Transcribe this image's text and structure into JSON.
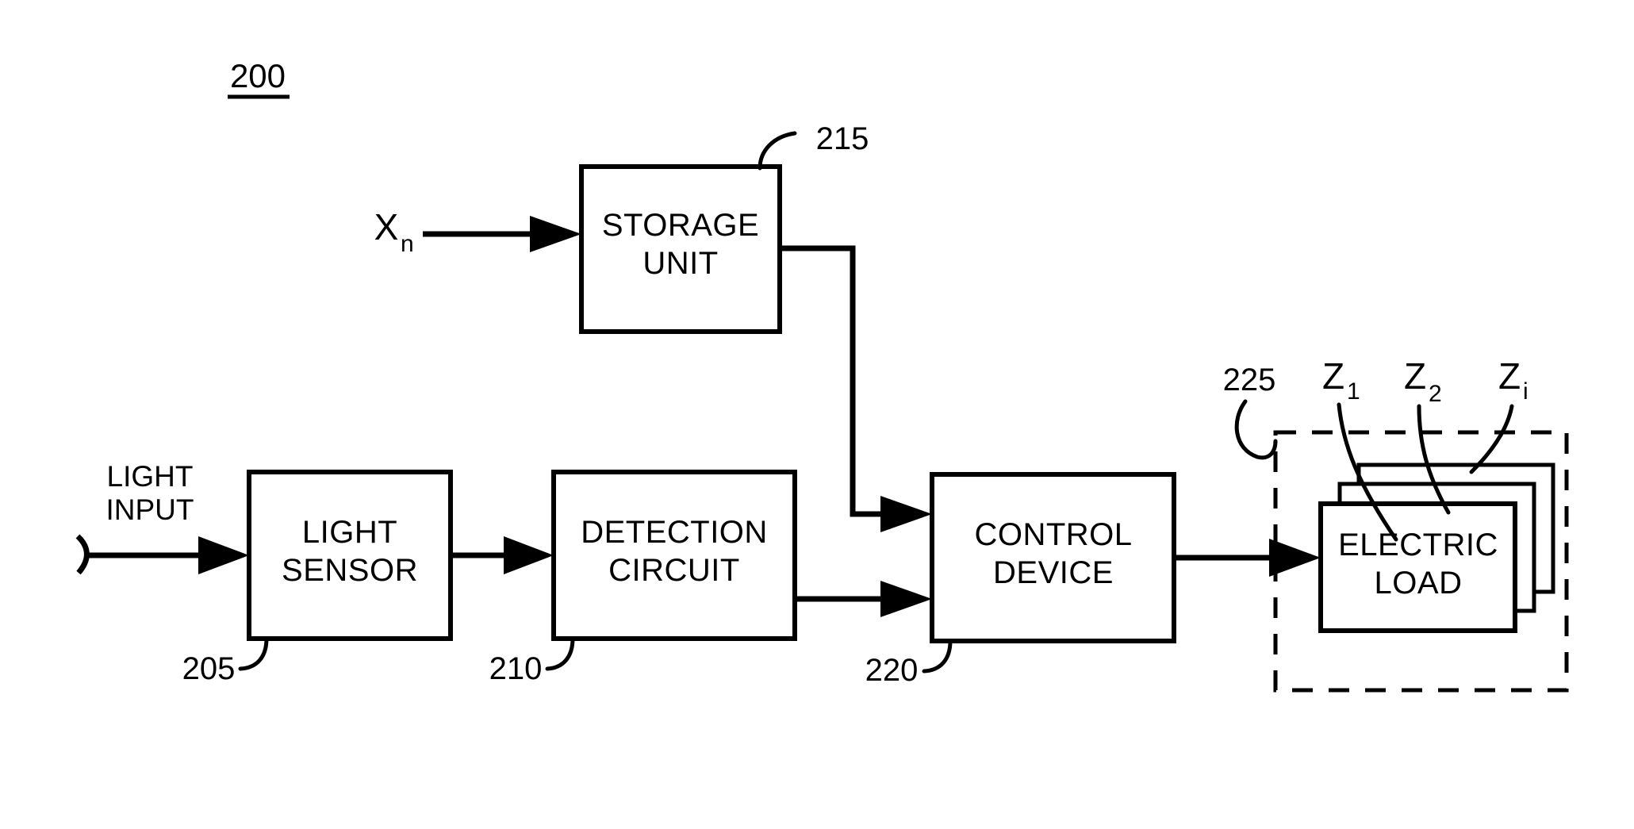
{
  "figure": {
    "number": "200",
    "background_color": "#ffffff",
    "line_color": "#000000"
  },
  "inputs": {
    "light_input_line1": "LIGHT",
    "light_input_line2": "INPUT",
    "storage_input_symbol": "X",
    "storage_input_subscript": "n"
  },
  "blocks": [
    {
      "id": "storage-unit",
      "label_line1": "STORAGE",
      "label_line2": "UNIT",
      "ref": "215"
    },
    {
      "id": "light-sensor",
      "label_line1": "LIGHT",
      "label_line2": "SENSOR",
      "ref": "205"
    },
    {
      "id": "detection-circuit",
      "label_line1": "DETECTION",
      "label_line2": "CIRCUIT",
      "ref": "210"
    },
    {
      "id": "control-device",
      "label_line1": "CONTROL",
      "label_line2": "DEVICE",
      "ref": "220"
    },
    {
      "id": "electric-load",
      "label_line1": "ELECTRIC",
      "label_line2": "LOAD",
      "ref": "225"
    }
  ],
  "load_outputs": [
    {
      "symbol": "Z",
      "subscript": "1"
    },
    {
      "symbol": "Z",
      "subscript": "2"
    },
    {
      "symbol": "Z",
      "subscript": "i"
    }
  ]
}
